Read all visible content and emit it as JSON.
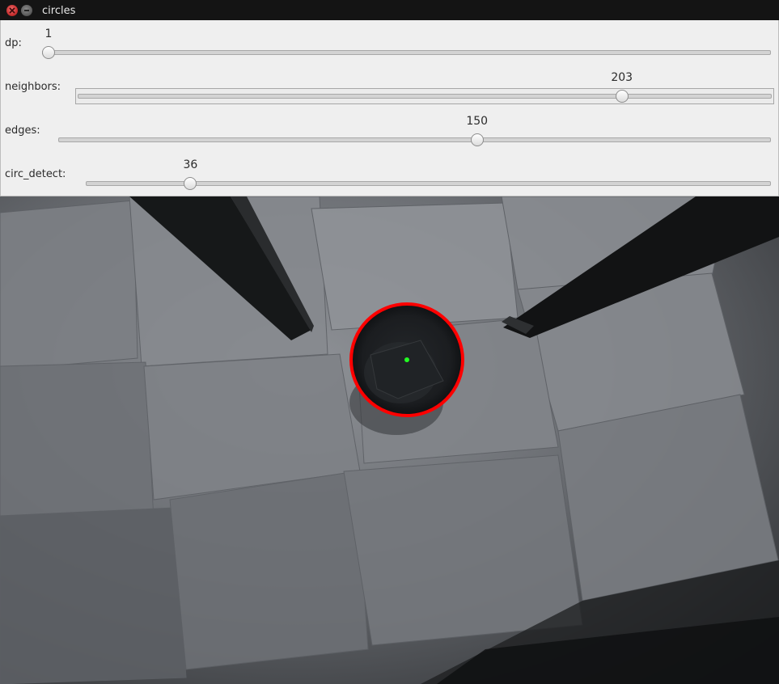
{
  "window": {
    "title": "circles"
  },
  "controls": [
    {
      "label": "dp:",
      "value": "1",
      "fraction": 0.0
    },
    {
      "label": "neighbors:",
      "value": "203",
      "fraction": 0.7913
    },
    {
      "label": "edges:",
      "value": "150",
      "fraction": 0.5906
    },
    {
      "label": "circ_detect:",
      "value": "36",
      "fraction": 0.1465
    }
  ],
  "detection": {
    "circle_color": "#ff0000",
    "center_color": "#22ff22"
  }
}
